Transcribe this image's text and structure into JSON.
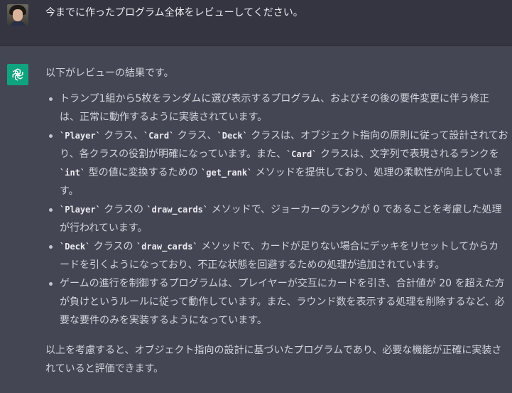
{
  "user_message": {
    "text": "今までに作ったプログラム全体をレビューしてください。"
  },
  "assistant_message": {
    "intro": "以下がレビューの結果です。",
    "points": [
      [
        {
          "t": "トランプ1組から5枚をランダムに選び表示するプログラム、およびその後の要件変更に伴う修正は、正常に動作するように実装されています。"
        }
      ],
      [
        {
          "c": "`Player`"
        },
        {
          "t": " クラス、"
        },
        {
          "c": "`Card`"
        },
        {
          "t": " クラス、"
        },
        {
          "c": "`Deck`"
        },
        {
          "t": " クラスは、オブジェクト指向の原則に従って設計されており、各クラスの役割が明確になっています。また、"
        },
        {
          "c": "`Card`"
        },
        {
          "t": " クラスは、文字列で表現されるランクを "
        },
        {
          "c": "`int`"
        },
        {
          "t": " 型の値に変換するための "
        },
        {
          "c": "`get_rank`"
        },
        {
          "t": " メソッドを提供しており、処理の柔軟性が向上しています。"
        }
      ],
      [
        {
          "c": "`Player`"
        },
        {
          "t": " クラスの "
        },
        {
          "c": "`draw_cards`"
        },
        {
          "t": " メソッドで、ジョーカーのランクが 0 であることを考慮した処理が行われています。"
        }
      ],
      [
        {
          "c": "`Deck`"
        },
        {
          "t": " クラスの "
        },
        {
          "c": "`draw_cards`"
        },
        {
          "t": " メソッドで、カードが足りない場合にデッキをリセットしてからカードを引くようになっており、不正な状態を回避するための処理が追加されています。"
        }
      ],
      [
        {
          "t": "ゲームの進行を制御するプログラムは、プレイヤーが交互にカードを引き、合計値が 20 を超えた方が負けというルールに従って動作しています。また、ラウンド数を表示する処理を削除するなど、必要な要件のみを実装するようになっています。"
        }
      ]
    ],
    "outro": "以上を考慮すると、オブジェクト指向の設計に基づいたプログラムであり、必要な機能が正確に実装されていると評価できます。"
  },
  "colors": {
    "user_bg": "#343541",
    "assistant_bg": "#444654",
    "gpt_logo_bg": "#10a37f",
    "text": "#d1d5db"
  },
  "icons": {
    "user_avatar": "user-avatar",
    "assistant_avatar": "openai-logo-icon",
    "bullet": "bullet-dot"
  }
}
